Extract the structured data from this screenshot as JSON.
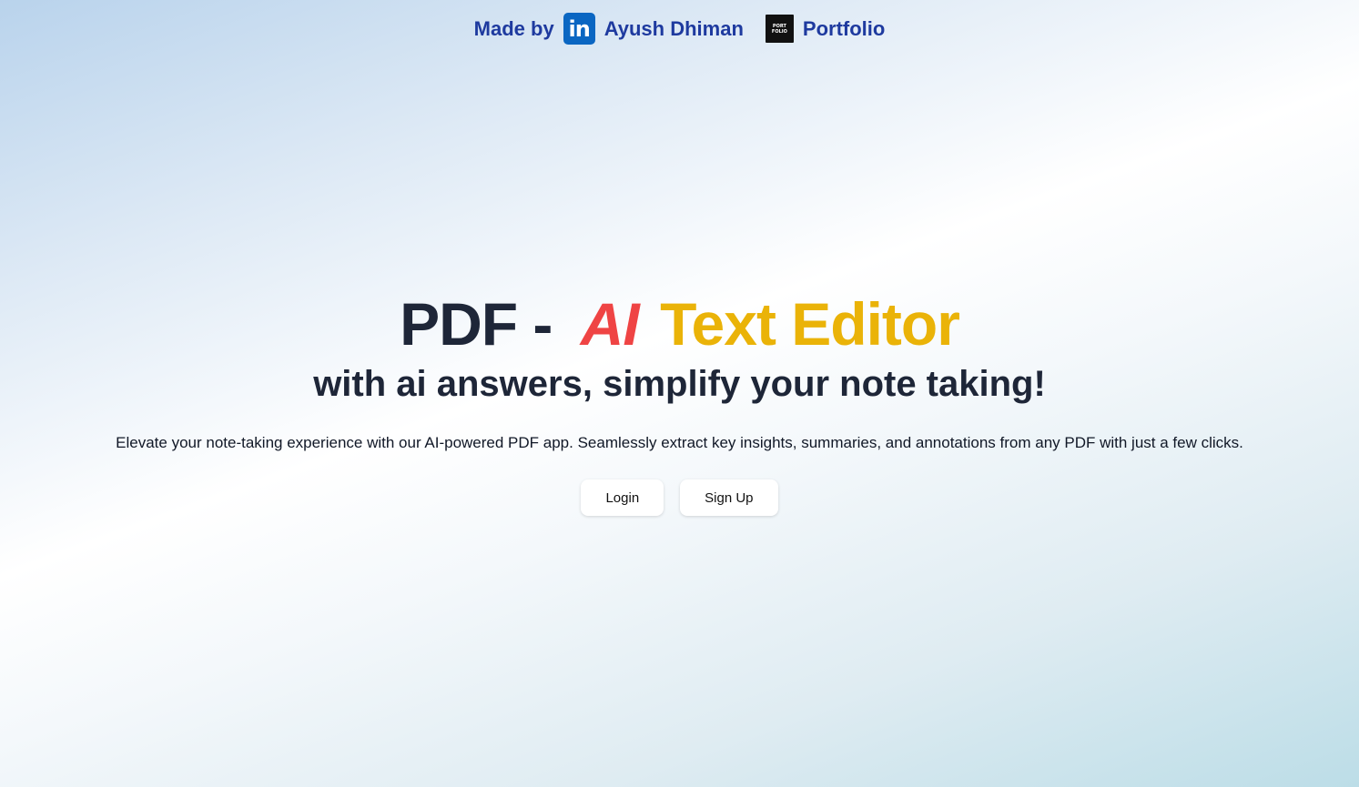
{
  "topbar": {
    "made_by_label": "Made by",
    "linkedin_icon_text": "in",
    "author_name": "Ayush Dhiman",
    "portfolio_icon_text_line1": "PORT",
    "portfolio_icon_text_line2": "FOLIO",
    "portfolio_label": "Portfolio"
  },
  "hero": {
    "title_part1": "PDF -",
    "title_ai": "AI",
    "title_part2": "Text Editor",
    "subtitle": "with ai answers, simplify your note taking!",
    "description": "Elevate your note-taking experience with our AI-powered PDF app. Seamlessly extract key insights, summaries, and annotations from any PDF with just a few clicks."
  },
  "actions": {
    "login_label": "Login",
    "signup_label": "Sign Up"
  },
  "colors": {
    "title_dark": "#1e2638",
    "title_ai": "#ef4444",
    "title_accent": "#eab308",
    "link_blue": "#1e3a9f",
    "linkedin_blue": "#0a66c2"
  }
}
